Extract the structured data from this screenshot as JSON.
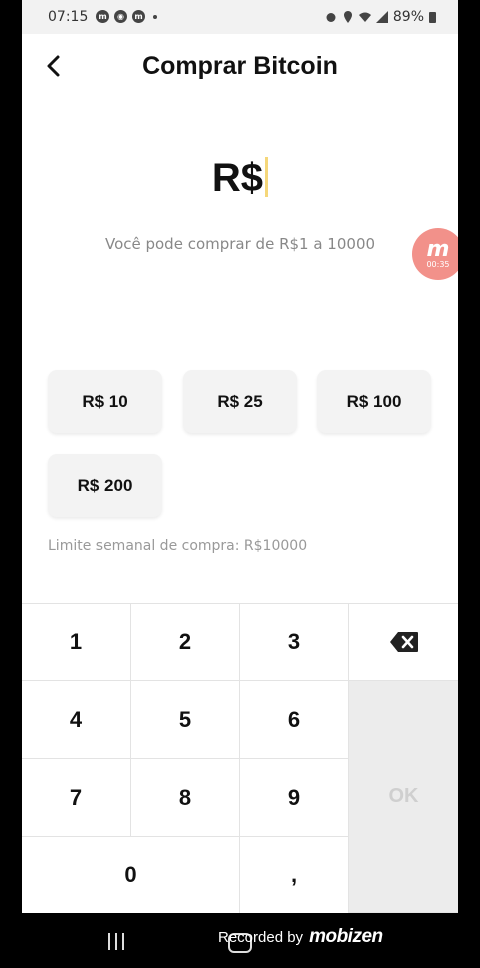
{
  "status_bar": {
    "time": "07:15",
    "notification_icons": [
      "m",
      "chrome",
      "m"
    ],
    "battery": "89%"
  },
  "header": {
    "title": "Comprar Bitcoin"
  },
  "amount": {
    "value": "R$",
    "hint": "Você pode comprar de R$1 a 10000"
  },
  "mobizen_bubble": {
    "time": "00:35"
  },
  "quick_amounts": [
    "R$ 10",
    "R$ 25",
    "R$ 100",
    "R$ 200"
  ],
  "weekly_limit": "Limite semanal de compra:  R$10000",
  "keypad": {
    "keys": [
      "1",
      "2",
      "3",
      "4",
      "5",
      "6",
      "7",
      "8",
      "9",
      "0",
      ","
    ],
    "ok_label": "OK"
  },
  "footer": {
    "recorded_by": "Recorded by",
    "brand": "MOBIZEN"
  },
  "colors": {
    "cursor": "#f5d77a",
    "ok_disabled": "#cfcfcf",
    "bubble": "#f2918a"
  }
}
